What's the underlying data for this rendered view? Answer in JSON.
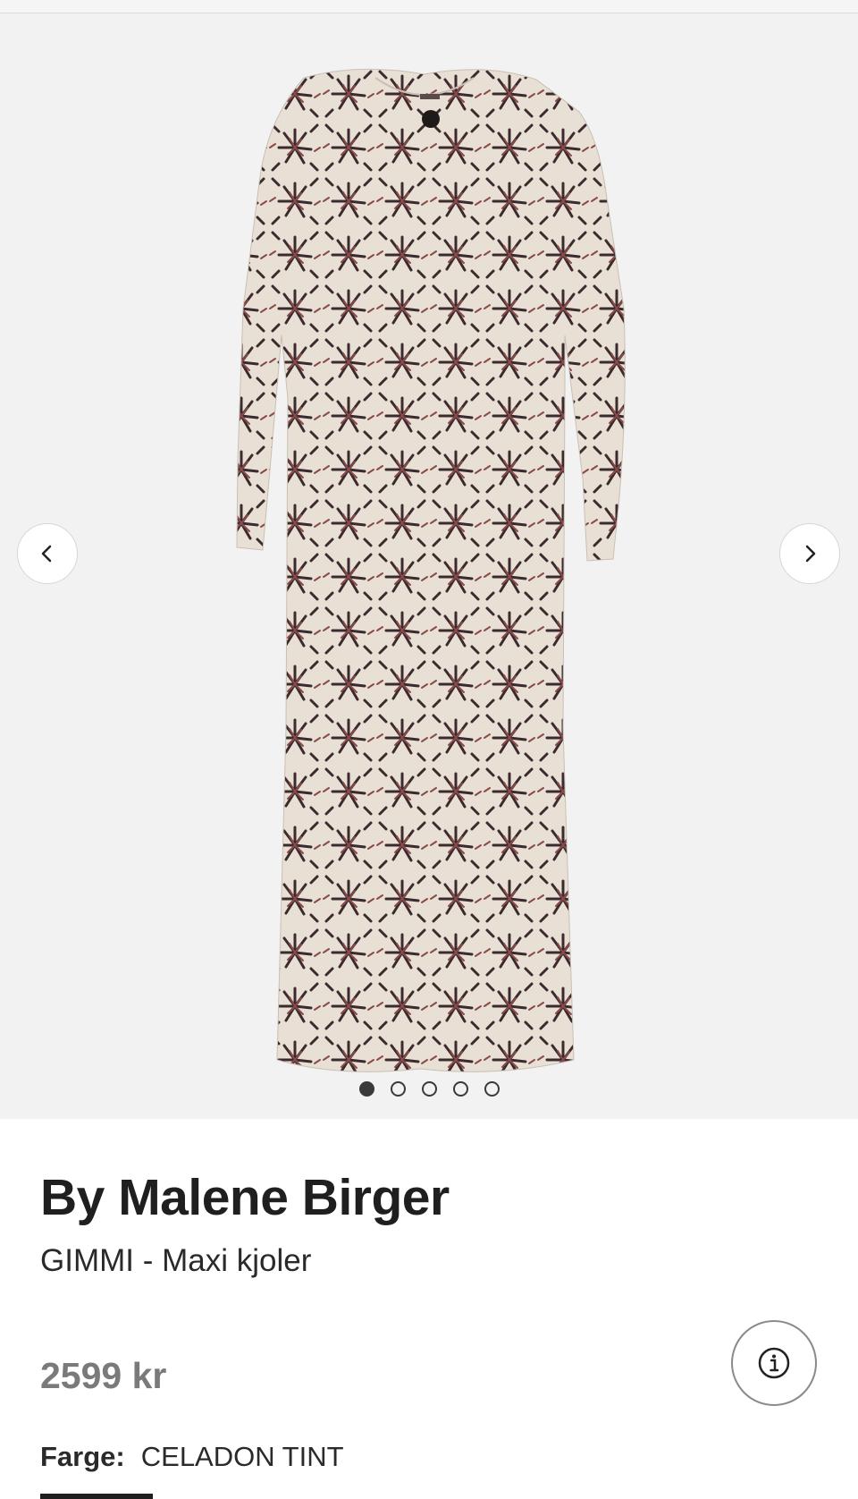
{
  "product": {
    "brand": "By Malene Birger",
    "name": "GIMMI - Maxi kjoler",
    "price": "2599 kr",
    "color_label": "Farge:",
    "color_value": "CELADON TINT"
  },
  "gallery": {
    "image_count": 5,
    "active_index": 0,
    "prev_icon": "chevron-left-icon",
    "next_icon": "chevron-right-icon"
  },
  "icons": {
    "info": "info-icon"
  },
  "colors": {
    "background": "#f2f2f2",
    "text_primary": "#1f1f1f",
    "price_text": "#7a7a7a",
    "dress_base": "#e8ddd2",
    "dress_pattern_dark": "#3b2a2e",
    "dress_pattern_red": "#8a4a4a"
  }
}
